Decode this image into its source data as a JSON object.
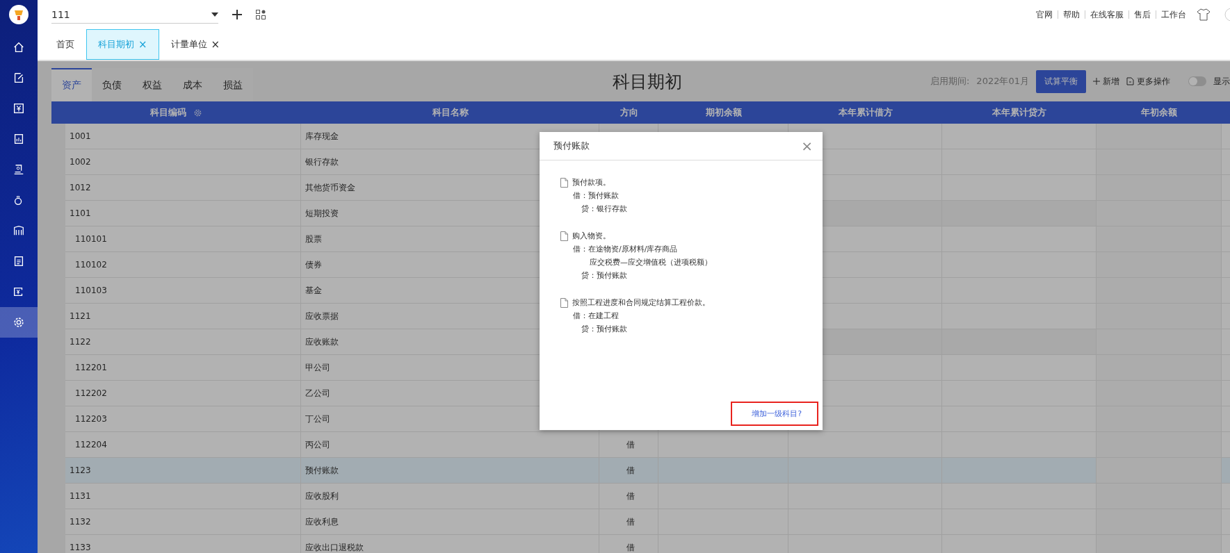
{
  "company_select": {
    "value": "111"
  },
  "top_links": [
    "官网",
    "帮助",
    "在线客服",
    "售后",
    "工作台"
  ],
  "sidebar": {
    "items": [
      {
        "selected": false
      },
      {
        "selected": false
      },
      {
        "selected": false
      },
      {
        "selected": false
      },
      {
        "selected": false
      },
      {
        "selected": false
      },
      {
        "selected": false
      },
      {
        "selected": false
      },
      {
        "selected": false
      },
      {
        "selected": true
      }
    ]
  },
  "tabs": [
    {
      "label": "首页",
      "selected": false
    },
    {
      "label": "科目期初",
      "selected": true,
      "close": "×"
    },
    {
      "label": "计量单位",
      "selected": false,
      "close": "×"
    }
  ],
  "category_tabs": [
    {
      "label": "资产",
      "selected": true
    },
    {
      "label": "负债",
      "selected": false
    },
    {
      "label": "权益",
      "selected": false
    },
    {
      "label": "成本",
      "selected": false
    },
    {
      "label": "损益",
      "selected": false
    }
  ],
  "page_title": "科目期初",
  "period_label": "启用期间:",
  "period_value": "2022年01月",
  "actions": {
    "balance_button": "试算平衡",
    "add": "新增",
    "more": "更多操作",
    "toggle_label": "显示",
    "toggle_on": false
  },
  "table": {
    "columns": [
      "科目编码",
      "科目名称",
      "方向",
      "期初余额",
      "本年累计借方",
      "本年累计贷方",
      "年初余额"
    ],
    "rows": [
      {
        "code": "1001",
        "name": "库存现金",
        "selected": false
      },
      {
        "code": "1002",
        "name": "银行存款",
        "selected": false
      },
      {
        "code": "1012",
        "name": "其他货币资金",
        "selected": false
      },
      {
        "code": "1101",
        "name": "短期投资",
        "selected": false,
        "children": [
          {
            "code": "110101",
            "name": "股票",
            "selected": false
          },
          {
            "code": "110102",
            "name": "债券",
            "selected": false
          },
          {
            "code": "110103",
            "name": "基金",
            "selected": false
          }
        ]
      },
      {
        "code": "1121",
        "name": "应收票据",
        "selected": false
      },
      {
        "code": "1122",
        "name": "应收账款",
        "selected": false,
        "children": [
          {
            "code": "112201",
            "name": "甲公司",
            "selected": false
          },
          {
            "code": "112202",
            "name": "乙公司",
            "selected": false
          },
          {
            "code": "112203",
            "name": "丁公司",
            "selected": false
          },
          {
            "code": "112204",
            "name": "丙公司",
            "direction": "借",
            "selected": false
          }
        ]
      },
      {
        "code": "1123",
        "name": "预付账款",
        "direction": "借",
        "selected": true
      },
      {
        "code": "1131",
        "name": "应收股利",
        "direction": "借",
        "selected": false
      },
      {
        "code": "1132",
        "name": "应收利息",
        "direction": "借",
        "selected": false
      },
      {
        "code": "1133",
        "name": "应收出口退税款",
        "direction": "借",
        "selected": false
      }
    ]
  },
  "dialog": {
    "title": "预付账款",
    "close": "×",
    "entries": [
      {
        "title": "预付款项。",
        "lines": [
          {
            "kind": "debit",
            "text": "借：预付账款"
          },
          {
            "kind": "credit",
            "text": "贷：银行存款"
          }
        ]
      },
      {
        "title": "购入物资。",
        "lines": [
          {
            "kind": "debit",
            "text": "借：在途物资/原材料/库存商品"
          },
          {
            "kind": "continued",
            "text": "应交税费—应交增值税（进项税额）"
          },
          {
            "kind": "credit",
            "text": "贷：预付账款"
          }
        ]
      },
      {
        "title": "按照工程进度和合同规定结算工程价款。",
        "lines": [
          {
            "kind": "debit",
            "text": "借：在建工程"
          },
          {
            "kind": "credit",
            "text": "贷：预付账款"
          }
        ]
      }
    ],
    "link": {
      "text": "增加一级科目?",
      "highlighted": true
    }
  }
}
